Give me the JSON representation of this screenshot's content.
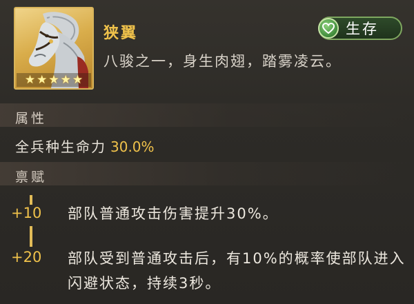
{
  "item": {
    "name": "狭翼",
    "stars": 5,
    "description": "八骏之一，身生肉翅，踏雾凌云。",
    "category": {
      "label": "生存",
      "icon": "heart-icon",
      "color": "#7fa860"
    }
  },
  "attributes": {
    "title": "属性",
    "stat_label": "全兵种生命力",
    "stat_value": "30.0%"
  },
  "talents": {
    "title": "禀赋",
    "items": [
      {
        "level": "+10",
        "text": "部队普通攻击伤害提升30%。"
      },
      {
        "level": "+20",
        "text": "部队受到普通攻击后，有10%的概率使部队进入闪避状态，持续3秒。"
      }
    ]
  },
  "colors": {
    "accent_gold": "#f0c24b",
    "background": "#2b2925"
  }
}
